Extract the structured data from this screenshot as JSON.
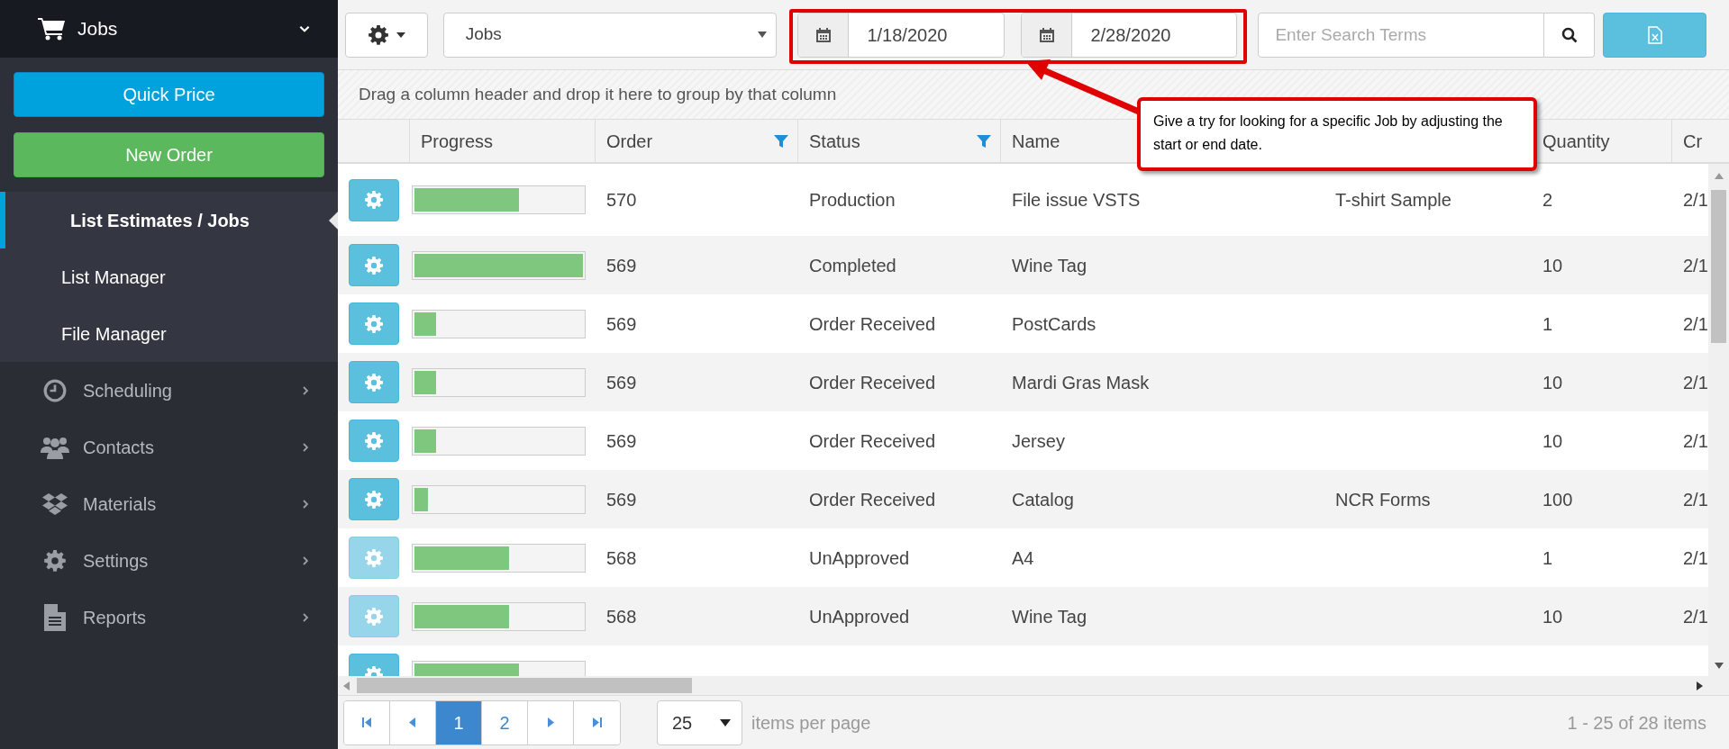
{
  "sidebar": {
    "header": {
      "label": "Jobs",
      "expanded": true
    },
    "buttons": [
      {
        "label": "Quick Price",
        "kind": "primary"
      },
      {
        "label": "New Order",
        "kind": "success"
      }
    ],
    "submenu": [
      {
        "label": "List Estimates / Jobs",
        "selected": true
      },
      {
        "label": "List Manager",
        "selected": false
      },
      {
        "label": "File Manager",
        "selected": false
      }
    ],
    "items": [
      {
        "label": "Scheduling",
        "kind": "clock"
      },
      {
        "label": "Contacts",
        "kind": "users"
      },
      {
        "label": "Materials",
        "kind": "boxes"
      },
      {
        "label": "Settings",
        "kind": "gear"
      },
      {
        "label": "Reports",
        "kind": "file"
      }
    ]
  },
  "toolbar": {
    "view": "Jobs",
    "start_date": "1/18/2020",
    "end_date": "2/28/2020",
    "search": {
      "placeholder": "Enter Search Terms"
    }
  },
  "group_hint": "Drag a column header and drop it here to group by that column",
  "callout": "Give a try for looking for a specific Job by adjusting the start or end date.",
  "table": {
    "progress_column": "Progress",
    "columns": [
      {
        "label": "Order",
        "filtered": true
      },
      {
        "label": "Status",
        "filtered": true
      },
      {
        "label": "Name"
      },
      null,
      {
        "label": "Quantity"
      },
      {
        "label": "Cr"
      }
    ],
    "rows": [
      {
        "level": 0.62,
        "disabled": false,
        "cells": [
          "570",
          "Production",
          "File issue VSTS",
          "T-shirt Sample",
          "2",
          "2/1"
        ]
      },
      {
        "level": 1,
        "disabled": false,
        "cells": [
          "569",
          "Completed",
          "Wine Tag",
          "",
          "10",
          "2/1"
        ]
      },
      {
        "level": 0.13,
        "disabled": false,
        "cells": [
          "569",
          "Order Received",
          "PostCards",
          "",
          "1",
          "2/1"
        ]
      },
      {
        "level": 0.13,
        "disabled": false,
        "cells": [
          "569",
          "Order Received",
          "Mardi Gras Mask",
          "",
          "10",
          "2/1"
        ]
      },
      {
        "level": 0.13,
        "disabled": false,
        "cells": [
          "569",
          "Order Received",
          "Jersey",
          "",
          "10",
          "2/1"
        ]
      },
      {
        "level": 0.08,
        "disabled": false,
        "cells": [
          "569",
          "Order Received",
          "Catalog",
          "NCR Forms",
          "100",
          "2/1"
        ]
      },
      {
        "level": 0.56,
        "disabled": true,
        "cells": [
          "568",
          "UnApproved",
          "A4",
          "",
          "1",
          "2/1"
        ]
      },
      {
        "level": 0.56,
        "disabled": true,
        "cells": [
          "568",
          "UnApproved",
          "Wine Tag",
          "",
          "10",
          "2/1"
        ]
      },
      {
        "level": 0.62,
        "disabled": false
      }
    ]
  },
  "pager": {
    "pages": [
      {
        "label": "1",
        "selected": true
      },
      {
        "label": "2",
        "selected": false
      }
    ],
    "page_size": "25",
    "per_page_label": "items per page",
    "summary": "1 - 25 of 28 items"
  }
}
